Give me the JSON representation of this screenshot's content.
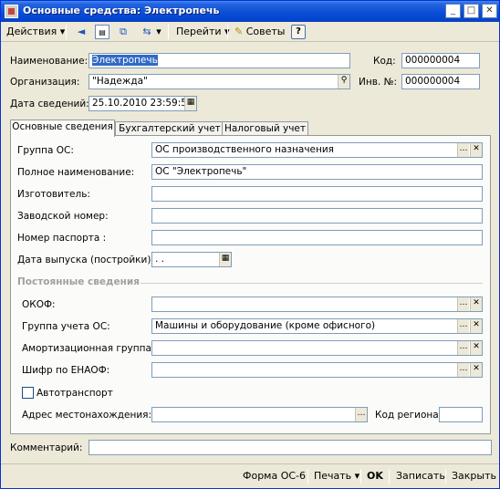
{
  "window": {
    "title": "Основные средства: Электропечь"
  },
  "toolbar": {
    "actions": "Действия",
    "goto": "Перейти",
    "tips": "Советы",
    "help": "?"
  },
  "form": {
    "name_label": "Наименование:",
    "name_value": "Электропечь",
    "code_label": "Код:",
    "code_value": "000000004",
    "org_label": "Организация:",
    "org_value": "\"Надежда\"",
    "inv_label": "Инв. №:",
    "inv_value": "000000004",
    "date_label": "Дата сведений:",
    "date_value": "25.10.2010 23:59:59"
  },
  "tabs": [
    "Основные сведения",
    "Бухгалтерский учет",
    "Налоговый учет"
  ],
  "main": {
    "group_label": "Группа ОС:",
    "group_value": "ОС производственного назначения",
    "fullname_label": "Полное наименование:",
    "fullname_value": "ОС \"Электропечь\"",
    "maker_label": "Изготовитель:",
    "maker_value": "",
    "serial_label": "Заводской номер:",
    "serial_value": "",
    "passport_label": "Номер паспорта :",
    "passport_value": "",
    "release_label": "Дата выпуска (постройки):",
    "release_value": " .  .",
    "const_title": "Постоянные сведения",
    "okof_label": "ОКОФ:",
    "okof_value": "",
    "acc_group_label": "Группа учета ОС:",
    "acc_group_value": "Машины и оборудование (кроме офисного)",
    "amort_label": "Амортизационная группа:",
    "amort_value": "",
    "enaof_label": "Шифр по ЕНАОФ:",
    "enaof_value": "",
    "auto_label": "Автотранспорт",
    "address_label": "Адрес местонахождения:",
    "address_value": "",
    "region_label": "Код региона:",
    "region_value": ""
  },
  "comment": {
    "label": "Комментарий:",
    "value": ""
  },
  "bottom": {
    "form_os6": "Форма ОС-6",
    "print": "Печать",
    "ok": "OK",
    "save": "Записать",
    "close": "Закрыть"
  }
}
